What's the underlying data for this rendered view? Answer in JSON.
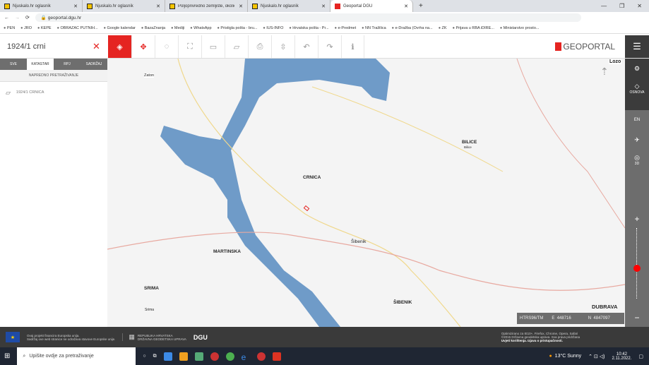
{
  "browser": {
    "tabs": [
      "Njuskalo.hr oglasnik",
      "Njuskalo.hr oglasnik",
      "Poljoprivredno zemljište, okolica",
      "Njuskalo.hr oglasnik",
      "Geoportal DGU"
    ],
    "url": "geoportal.dgu.hr",
    "bookmarks": [
      "PEN",
      "JRO",
      "KEPE",
      "OBRAZAC PUTNIH...",
      "Google kalendar",
      "BazaZnanja",
      "Mediji",
      "WhatsApp",
      "Pristigla pošta - bru...",
      "IUS-INFO",
      "Hrvatska pošta - Pr...",
      "e-Predmet",
      "NN Tražilica",
      "e-Dražba (Ovrha na...",
      "ZK",
      "Prijava u RBA iDIRE...",
      "Ministarstvo prosto..."
    ]
  },
  "header": {
    "search_value": "1924/1 crni",
    "logo": "GEOPORTAL"
  },
  "panel": {
    "tabs": [
      "SVE",
      "KATASTAR",
      "RPJ",
      "SADRŽAJ"
    ],
    "advanced": "NAPREDNO PRETRAŽIVANJE",
    "result": "1924/1 CRNICA"
  },
  "map": {
    "labels": {
      "zaton": "Zaton",
      "lozovac": "Lozo",
      "bilice": "BILICE",
      "bilice_small": "Bilice",
      "crnica": "CRNICA",
      "sibenik_small": "Šibenik",
      "martinska": "MARTINSKA",
      "srima": "SRIMA",
      "srima_small": "Srima",
      "sibenik": "ŠIBENIK",
      "dubrava": "DUBRAVA"
    }
  },
  "sidebar": {
    "osnova": "OSNOVA",
    "en": "EN",
    "d3": "3D",
    "zoom_level": 0.6
  },
  "coords": {
    "crs": "HTRS96/TM",
    "e_label": "E",
    "e": "448716",
    "n_label": "N",
    "n": "4847097"
  },
  "footer": {
    "eu_line1": "Ovaj projekt financira Europska unija.",
    "eu_line2": "Sadržaj ove web stranice ne odražava stavove Europske unije.",
    "gov1": "REPUBLIKA HRVATSKA",
    "gov2": "DRŽAVNA GEODETSKA UPRAVA",
    "dgu": "DGU",
    "right1": "Optimizirano za IE10+, Firefox, Chrome, Opera, Safari",
    "right2": "©2015 Državna geodetska uprava. Sva prava pridržana",
    "right3": "Uvjeti korištenja. Izjava o pristupačnosti."
  },
  "taskbar": {
    "search": "Upišite ovdje za pretraživanje",
    "weather": "13°C  Sunny",
    "time": "10:42",
    "date": "2.11.2022."
  }
}
